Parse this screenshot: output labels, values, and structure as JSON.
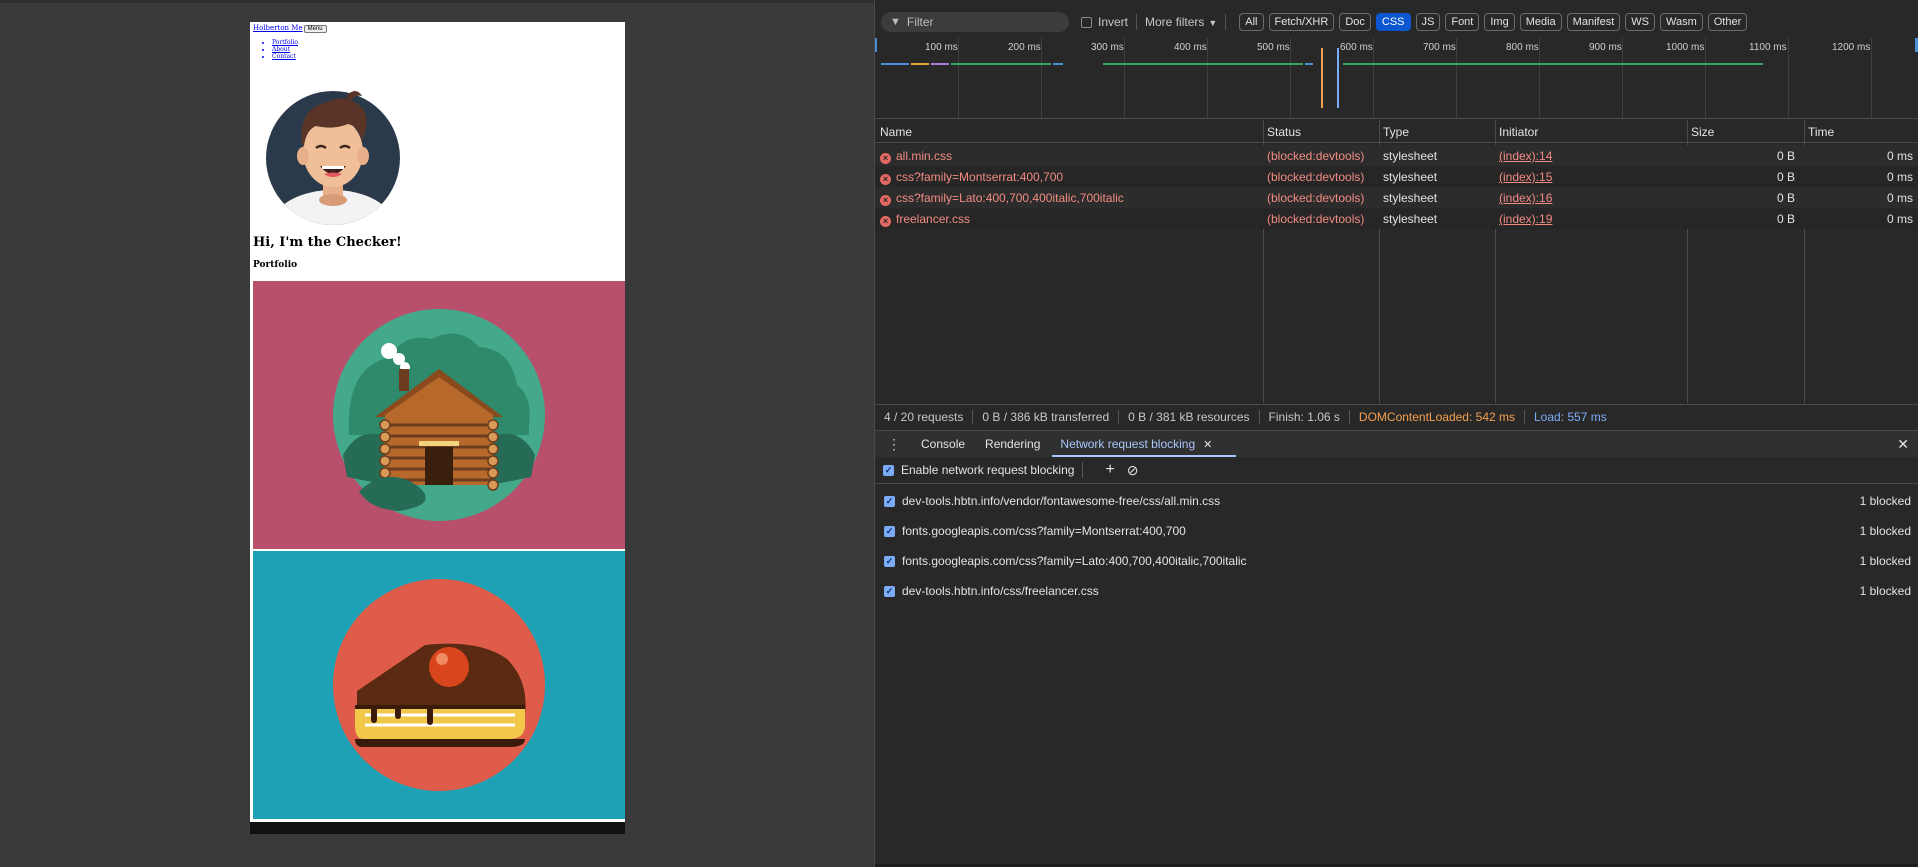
{
  "page": {
    "brand": "Holberton Me",
    "menu_button": "Menu",
    "nav": [
      "Portfolio",
      "About",
      "Contact"
    ],
    "heading": "Hi, I'm the Checker!",
    "subheading": "Portfolio"
  },
  "devtools": {
    "filter_placeholder": "Filter",
    "invert_label": "Invert",
    "more_filters": "More filters",
    "type_filters": [
      "All",
      "Fetch/XHR",
      "Doc",
      "CSS",
      "JS",
      "Font",
      "Img",
      "Media",
      "Manifest",
      "WS",
      "Wasm",
      "Other"
    ],
    "active_filter": "CSS",
    "timeline_ticks": [
      "100 ms",
      "200 ms",
      "300 ms",
      "400 ms",
      "500 ms",
      "600 ms",
      "700 ms",
      "800 ms",
      "900 ms",
      "1000 ms",
      "1100 ms",
      "1200 ms"
    ],
    "columns": {
      "name": "Name",
      "status": "Status",
      "type": "Type",
      "initiator": "Initiator",
      "size": "Size",
      "time": "Time"
    },
    "requests": [
      {
        "name": "all.min.css",
        "status": "(blocked:devtools)",
        "type": "stylesheet",
        "initiator": "(index):14",
        "size": "0 B",
        "time": "0 ms"
      },
      {
        "name": "css?family=Montserrat:400,700",
        "status": "(blocked:devtools)",
        "type": "stylesheet",
        "initiator": "(index):15",
        "size": "0 B",
        "time": "0 ms"
      },
      {
        "name": "css?family=Lato:400,700,400italic,700italic",
        "status": "(blocked:devtools)",
        "type": "stylesheet",
        "initiator": "(index):16",
        "size": "0 B",
        "time": "0 ms"
      },
      {
        "name": "freelancer.css",
        "status": "(blocked:devtools)",
        "type": "stylesheet",
        "initiator": "(index):19",
        "size": "0 B",
        "time": "0 ms"
      }
    ],
    "summary": {
      "requests": "4 / 20 requests",
      "transferred": "0 B / 386 kB transferred",
      "resources": "0 B / 381 kB resources",
      "finish": "Finish: 1.06 s",
      "dom_content_loaded": "DOMContentLoaded: 542 ms",
      "load": "Load: 557 ms"
    },
    "drawer": {
      "tabs": [
        "Console",
        "Rendering",
        "Network request blocking"
      ],
      "active_tab": "Network request blocking",
      "enable_label": "Enable network request blocking",
      "patterns": [
        {
          "url": "dev-tools.hbtn.info/vendor/fontawesome-free/css/all.min.css",
          "count": "1 blocked"
        },
        {
          "url": "fonts.googleapis.com/css?family=Montserrat:400,700",
          "count": "1 blocked"
        },
        {
          "url": "fonts.googleapis.com/css?family=Lato:400,700,400italic,700italic",
          "count": "1 blocked"
        },
        {
          "url": "dev-tools.hbtn.info/css/freelancer.css",
          "count": "1 blocked"
        }
      ]
    },
    "colors": {
      "panel_bg": "#282828",
      "active_chip": "#0b57d0",
      "error_text": "#f28b82",
      "dom_content_loaded": "#f4a052",
      "load": "#7cacf8",
      "tile_cabin": "#b84f6b",
      "tile_cake": "#1fa1b5"
    }
  }
}
